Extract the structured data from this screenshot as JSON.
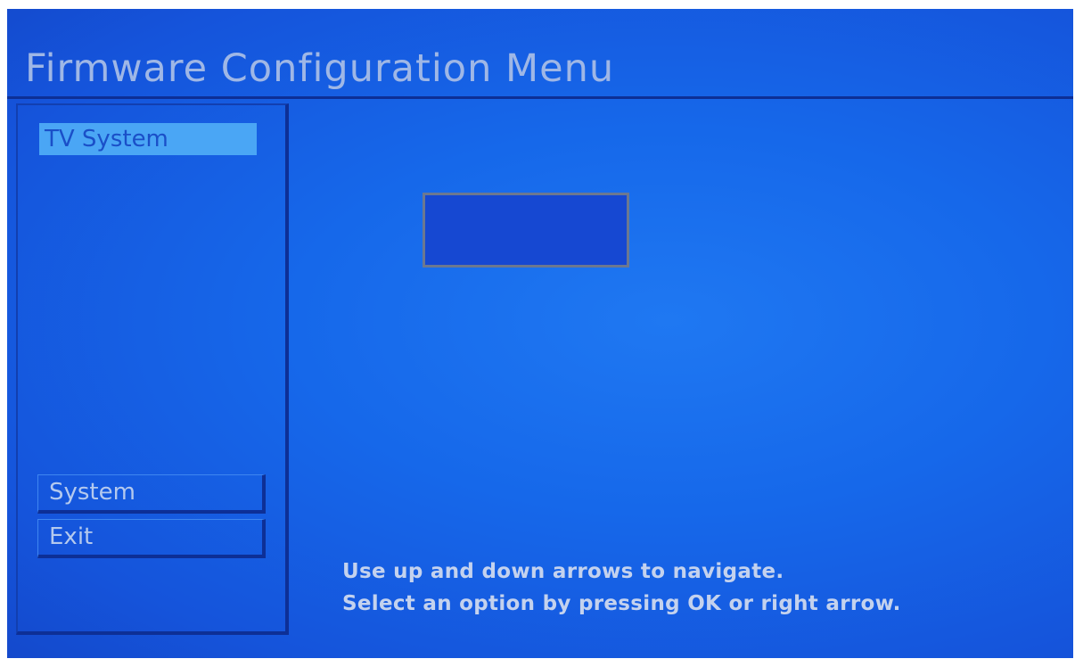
{
  "header": {
    "title": "Firmware Configuration Menu"
  },
  "sidebar": {
    "selected_item": "TV System",
    "buttons": [
      {
        "label": "System"
      },
      {
        "label": "Exit"
      }
    ]
  },
  "help": {
    "line1": "Use up and down arrows to navigate.",
    "line2": "Select an option by pressing OK or right arrow."
  }
}
